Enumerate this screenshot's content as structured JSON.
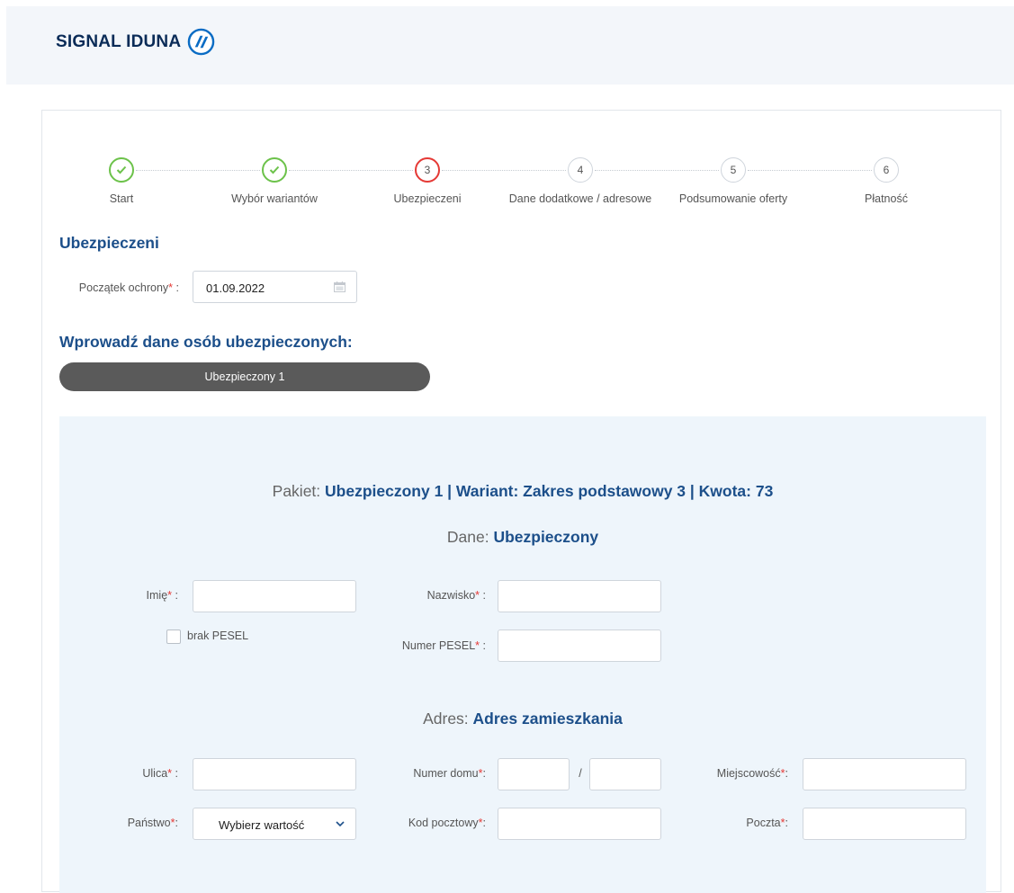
{
  "brand": {
    "name": "SIGNAL IDUNA"
  },
  "stepper": [
    {
      "number": "1",
      "label": "Start",
      "state": "done"
    },
    {
      "number": "2",
      "label": "Wybór wariantów",
      "state": "done"
    },
    {
      "number": "3",
      "label": "Ubezpieczeni",
      "state": "active"
    },
    {
      "number": "4",
      "label": "Dane dodatkowe / adresowe",
      "state": "todo"
    },
    {
      "number": "5",
      "label": "Podsumowanie oferty",
      "state": "todo"
    },
    {
      "number": "6",
      "label": "Płatność",
      "state": "todo"
    }
  ],
  "section": {
    "title": "Ubezpieczeni",
    "start_label": "Początek ochrony",
    "start_value": "01.09.2022",
    "persons_title": "Wprowadź dane osób ubezpieczonych:",
    "tab_label": "Ubezpieczony 1"
  },
  "panel": {
    "package_prefix": "Pakiet:",
    "package_value": "Ubezpieczony 1 | Wariant: Zakres podstawowy 3 | Kwota: 73",
    "data_prefix": "Dane:",
    "data_value": "Ubezpieczony",
    "address_prefix": "Adres:",
    "address_value": "Adres zamieszkania"
  },
  "fields": {
    "first_name": "Imię",
    "last_name": "Nazwisko",
    "no_pesel": "brak PESEL",
    "pesel": "Numer PESEL",
    "street": "Ulica",
    "house_number": "Numer domu",
    "separator": "/",
    "city": "Miejscowość",
    "country": "Państwo",
    "country_value": "Wybierz wartość",
    "postal_code": "Kod pocztowy",
    "post_office": "Poczta",
    "required_mark": "*",
    "colon": ":"
  },
  "colors": {
    "brand_blue": "#1c4f8a",
    "done_green": "#6cc24a",
    "active_red": "#e53935",
    "panel_bg": "#eef5fb"
  }
}
